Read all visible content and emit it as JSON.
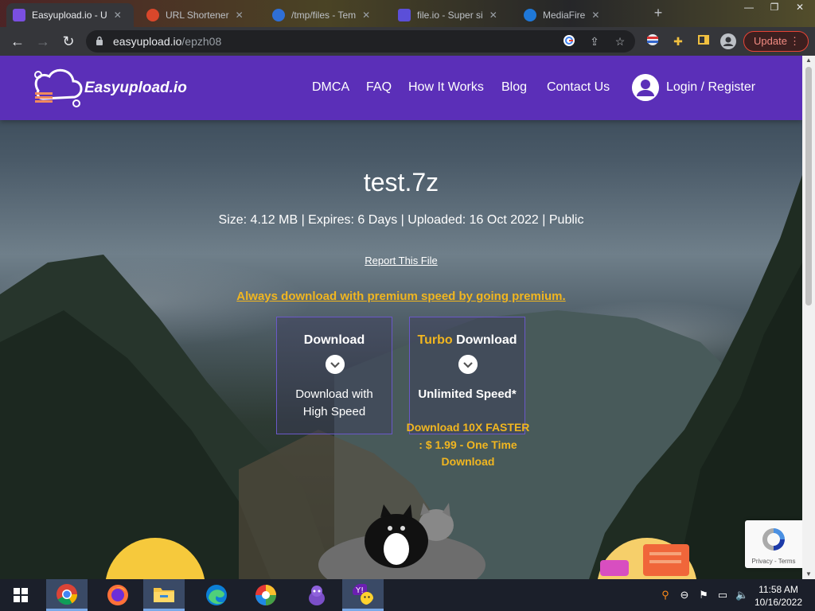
{
  "browser": {
    "tabs": [
      {
        "title": "Easyupload.io - U",
        "active": true
      },
      {
        "title": "URL Shortener",
        "active": false
      },
      {
        "title": "/tmp/files - Tem",
        "active": false
      },
      {
        "title": "file.io - Super si",
        "active": false
      },
      {
        "title": "MediaFire",
        "active": false
      }
    ],
    "url_domain": "easyupload.io",
    "url_path": "/epzh08",
    "update_label": "Update",
    "window_controls": {
      "minimize": "—",
      "maximize": "❐",
      "close": "✕"
    }
  },
  "site": {
    "brand": "Easyupload.io",
    "nav": [
      "DMCA",
      "FAQ",
      "How It Works",
      "Blog",
      "Contact Us"
    ],
    "login": "Login / Register"
  },
  "file": {
    "name": "test.7z",
    "meta": "Size: 4.12 MB | Expires: 6 Days | Uploaded: 16 Oct 2022 | Public",
    "report": "Report This File",
    "premium_link": "Always download with premium speed by going premium."
  },
  "download": {
    "free_title": "Download",
    "free_sub1": "Download with",
    "free_sub2": "High Speed",
    "turbo_word": "Turbo",
    "turbo_title": "Download",
    "turbo_sub": "Unlimited Speed*",
    "turbo_note1": "Download 10X FASTER",
    "turbo_note2": ": $ 1.99 - One Time",
    "turbo_note3": "Download"
  },
  "recaptcha": {
    "footer": "Privacy - Terms"
  },
  "taskbar": {
    "time": "11:58 AM",
    "date": "10/16/2022",
    "apps": [
      "start",
      "chrome",
      "firefox",
      "file-explorer",
      "edge",
      "picasa",
      "bonzi",
      "yahoo-messenger"
    ]
  },
  "colors": {
    "brand_purple": "#5b2fb8",
    "accent_gold": "#f1b620"
  }
}
